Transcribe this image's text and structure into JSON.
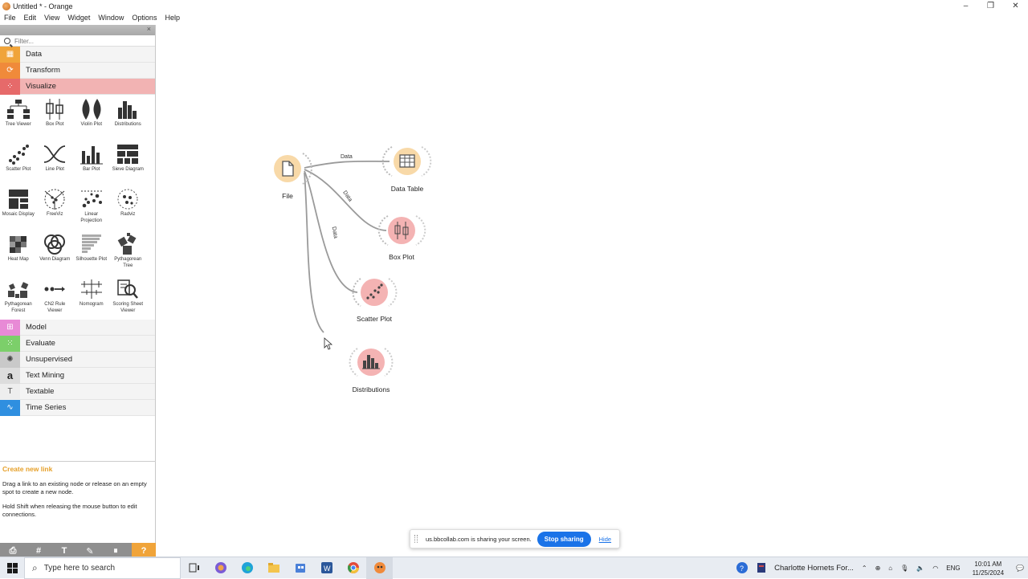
{
  "window": {
    "title": "Untitled * - Orange",
    "controls": {
      "minimize": "–",
      "restore": "❐",
      "close": "✕"
    }
  },
  "menu": [
    "File",
    "Edit",
    "View",
    "Widget",
    "Window",
    "Options",
    "Help"
  ],
  "toolbox": {
    "close_glyph": "×",
    "filter_placeholder": "Filter...",
    "categories_top": [
      {
        "label": "Data",
        "color": "#f0a43a",
        "glyph": "▦"
      },
      {
        "label": "Transform",
        "color": "#f08a3a",
        "glyph": "⟳"
      },
      {
        "label": "Visualize",
        "color": "#e66a6a",
        "glyph": "⁘"
      }
    ],
    "visualize_widgets": [
      "Tree Viewer",
      "Box Plot",
      "Violin Plot",
      "Distributions",
      "Scatter Plot",
      "Line Plot",
      "Bar Plot",
      "Sieve Diagram",
      "Mosaic Display",
      "FreeViz",
      "Linear Projection",
      "Radviz",
      "Heat Map",
      "Venn Diagram",
      "Silhouette Plot",
      "Pythagorean Tree",
      "Pythagorean Forest",
      "CN2 Rule Viewer",
      "Nomogram",
      "Scoring Sheet Viewer"
    ],
    "categories_bottom": [
      {
        "label": "Model",
        "color": "#e88ad6",
        "glyph": "⊞"
      },
      {
        "label": "Evaluate",
        "color": "#7ccf6a",
        "glyph": "⁙"
      },
      {
        "label": "Unsupervised",
        "color": "#c9c9c9",
        "glyph": "✺"
      },
      {
        "label": "Text Mining",
        "color": "#dddddd",
        "glyph": "a"
      },
      {
        "label": "Textable",
        "color": "#eeeeee",
        "glyph": "T"
      },
      {
        "label": "Time Series",
        "color": "#2f8fe0",
        "glyph": "∿"
      }
    ]
  },
  "info": {
    "title": "Create new link",
    "line1": "Drag a link to an existing node or release on an empty spot to create a new node.",
    "line2": "Hold Shift when releasing the mouse button to edit connections."
  },
  "bottom_tools": [
    "⎙",
    "#",
    "T",
    "✎",
    "⏸",
    "?"
  ],
  "canvas": {
    "nodes": {
      "file": "File",
      "data_table": "Data Table",
      "box_plot": "Box Plot",
      "scatter_plot": "Scatter Plot",
      "distributions": "Distributions"
    },
    "links": {
      "to_data_table": "Data",
      "to_box_plot": "Data",
      "to_scatter_plot": "Data"
    }
  },
  "share": {
    "message": "us.bbcollab.com is sharing your screen.",
    "stop": "Stop sharing",
    "hide": "Hide"
  },
  "taskbar": {
    "search_placeholder": "Type here to search",
    "news": "Charlotte Hornets For...",
    "lang": "ENG",
    "time": "10:01 AM",
    "date": "11/25/2024"
  }
}
